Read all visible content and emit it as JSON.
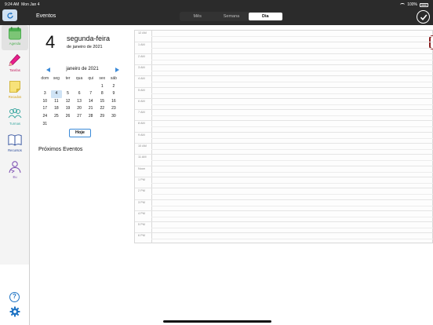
{
  "status": {
    "time": "9:24 AM",
    "date": "Mon Jan 4",
    "battery": "100%"
  },
  "header": {
    "title": "Eventos",
    "tabs": [
      {
        "label": "Mês",
        "active": false
      },
      {
        "label": "Semana",
        "active": false
      },
      {
        "label": "Dia",
        "active": true
      }
    ]
  },
  "sidebar": {
    "items": [
      {
        "label": "Agenda",
        "icon": "calendar-icon",
        "color": "#4caf50",
        "active": true
      },
      {
        "label": "Tarefas",
        "icon": "pencil-icon",
        "color": "#c2185b",
        "active": false
      },
      {
        "label": "Recados",
        "icon": "note-icon",
        "color": "#d4a017",
        "active": false
      },
      {
        "label": "Turmas",
        "icon": "group-icon",
        "color": "#3aa7a0",
        "active": false
      },
      {
        "label": "Recursos",
        "icon": "book-icon",
        "color": "#2a4a9a",
        "active": false
      },
      {
        "label": "Eu",
        "icon": "person-icon",
        "color": "#7a4ab0",
        "active": false
      }
    ]
  },
  "day": {
    "number": "4",
    "weekday": "segunda-feira",
    "full": "de janeiro de 2021"
  },
  "calendar": {
    "month": "janeiro de 2021",
    "weekdays": [
      "dom",
      "seg",
      "ter",
      "qua",
      "qui",
      "sex",
      "sáb"
    ],
    "weeks": [
      [
        "",
        "",
        "",
        "",
        "",
        "1",
        "2"
      ],
      [
        "3",
        "4",
        "5",
        "6",
        "7",
        "8",
        "9"
      ],
      [
        "10",
        "11",
        "12",
        "13",
        "14",
        "15",
        "16"
      ],
      [
        "17",
        "18",
        "19",
        "20",
        "21",
        "22",
        "23"
      ],
      [
        "24",
        "25",
        "26",
        "27",
        "28",
        "29",
        "30"
      ],
      [
        "31",
        "",
        "",
        "",
        "",
        "",
        ""
      ]
    ],
    "selected": "4",
    "today_label": "Hoje"
  },
  "events": {
    "title": "Próximos Eventos"
  },
  "dayview": {
    "hours": [
      "12 AM",
      "1 AM",
      "2 AM",
      "3 AM",
      "4 AM",
      "5 AM",
      "6 AM",
      "7 AM",
      "8 AM",
      "9 AM",
      "10 AM",
      "11 AM",
      "Noon",
      "1 PM",
      "2 PM",
      "3 PM",
      "4 PM",
      "5 PM",
      "6 PM"
    ]
  },
  "colors": {
    "accent": "#3b8ad8",
    "topbar": "#2b2b2b",
    "now_marker": "#8b1e1e"
  }
}
